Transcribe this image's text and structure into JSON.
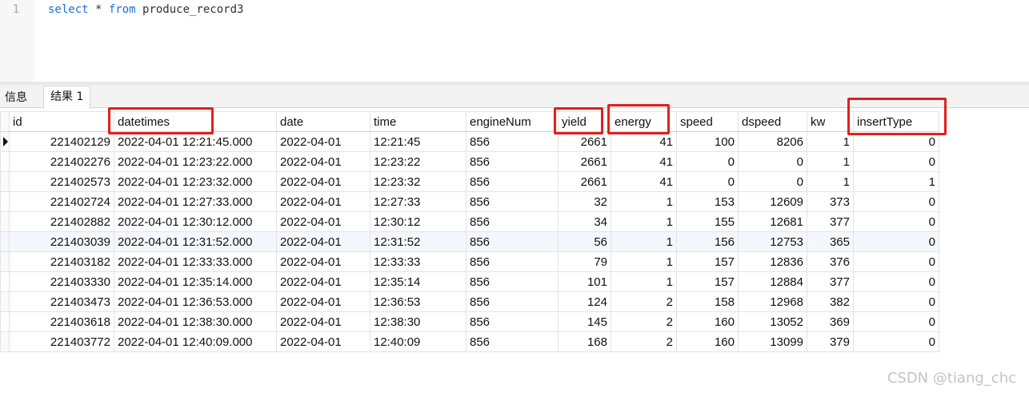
{
  "editor": {
    "line_number": "1",
    "keyword_select": "select",
    "star": " * ",
    "keyword_from": "from",
    "table_name": " produce_record3"
  },
  "tabs": [
    {
      "label": "信息"
    },
    {
      "label": "结果 1"
    }
  ],
  "grid": {
    "columns": [
      "id",
      "datetimes",
      "date",
      "time",
      "engineNum",
      "yield",
      "energy",
      "speed",
      "dspeed",
      "kw",
      "insertType"
    ],
    "rows": [
      [
        "221402129",
        "2022-04-01 12:21:45.000",
        "2022-04-01",
        "12:21:45",
        "856",
        "2661",
        "41",
        "100",
        "8206",
        "1",
        "0"
      ],
      [
        "221402276",
        "2022-04-01 12:23:22.000",
        "2022-04-01",
        "12:23:22",
        "856",
        "2661",
        "41",
        "0",
        "0",
        "1",
        "0"
      ],
      [
        "221402573",
        "2022-04-01 12:23:32.000",
        "2022-04-01",
        "12:23:32",
        "856",
        "2661",
        "41",
        "0",
        "0",
        "1",
        "1"
      ],
      [
        "221402724",
        "2022-04-01 12:27:33.000",
        "2022-04-01",
        "12:27:33",
        "856",
        "32",
        "1",
        "153",
        "12609",
        "373",
        "0"
      ],
      [
        "221402882",
        "2022-04-01 12:30:12.000",
        "2022-04-01",
        "12:30:12",
        "856",
        "34",
        "1",
        "155",
        "12681",
        "377",
        "0"
      ],
      [
        "221403039",
        "2022-04-01 12:31:52.000",
        "2022-04-01",
        "12:31:52",
        "856",
        "56",
        "1",
        "156",
        "12753",
        "365",
        "0"
      ],
      [
        "221403182",
        "2022-04-01 12:33:33.000",
        "2022-04-01",
        "12:33:33",
        "856",
        "79",
        "1",
        "157",
        "12836",
        "376",
        "0"
      ],
      [
        "221403330",
        "2022-04-01 12:35:14.000",
        "2022-04-01",
        "12:35:14",
        "856",
        "101",
        "1",
        "157",
        "12884",
        "377",
        "0"
      ],
      [
        "221403473",
        "2022-04-01 12:36:53.000",
        "2022-04-01",
        "12:36:53",
        "856",
        "124",
        "2",
        "158",
        "12968",
        "382",
        "0"
      ],
      [
        "221403618",
        "2022-04-01 12:38:30.000",
        "2022-04-01",
        "12:38:30",
        "856",
        "145",
        "2",
        "160",
        "13052",
        "369",
        "0"
      ],
      [
        "221403772",
        "2022-04-01 12:40:09.000",
        "2022-04-01",
        "12:40:09",
        "856",
        "168",
        "2",
        "160",
        "13099",
        "379",
        "0"
      ]
    ],
    "current_row_index": 0,
    "highlighted_row_index": 5
  },
  "annotations": {
    "highlighted_columns": [
      "datetimes",
      "yield",
      "energy",
      "insertType"
    ],
    "color": "#e0201c"
  },
  "watermark": "CSDN @tiang_chc",
  "colors": {
    "keyword": "#1f6fd8",
    "row_highlight": "#f4f8fc"
  }
}
